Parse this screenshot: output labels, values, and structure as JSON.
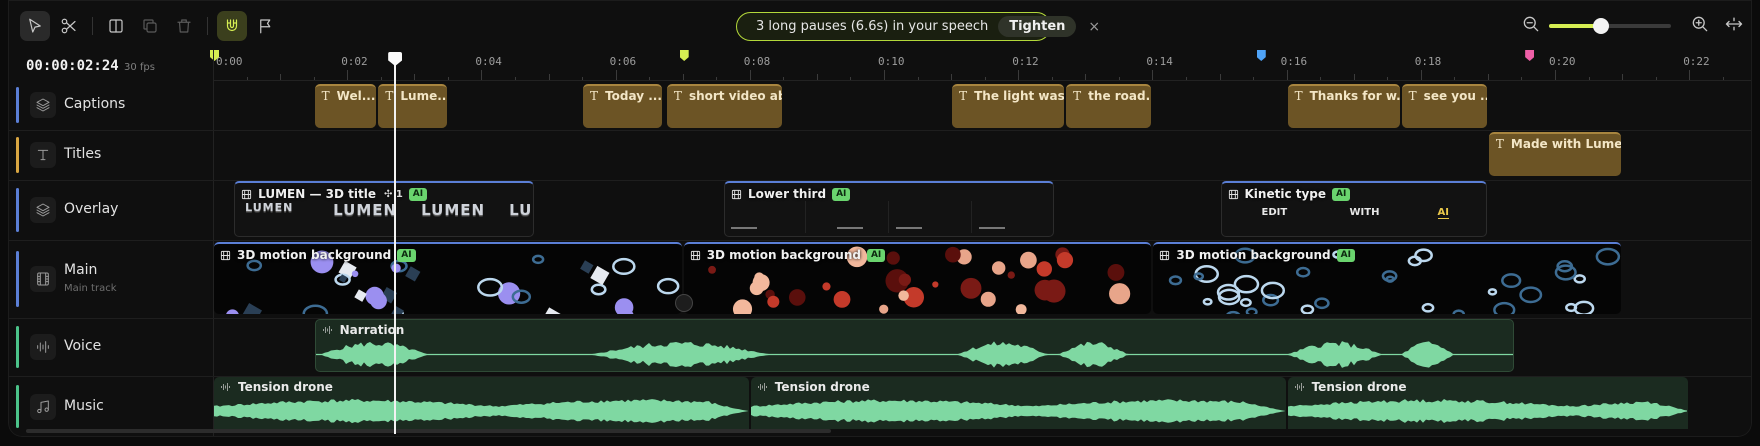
{
  "toolbar": {
    "tools": [
      {
        "name": "select-tool",
        "icon": "cursor-icon",
        "active": true
      },
      {
        "name": "cut-tool",
        "icon": "scissors-icon"
      },
      {
        "name": "split-tool",
        "icon": "split-icon"
      },
      {
        "name": "duplicate-tool",
        "icon": "copy-icon"
      },
      {
        "name": "delete-tool",
        "icon": "trash-icon"
      },
      {
        "name": "magnet-tool",
        "icon": "magnet-icon"
      },
      {
        "name": "marker-tool",
        "icon": "flag-icon"
      }
    ],
    "notice": {
      "message": "3 long pauses (6.6s) in your speech",
      "action": "Tighten",
      "close": "×"
    },
    "zoom": {
      "level": 0.43
    }
  },
  "header": {
    "timecode": "00:00:02:24",
    "fps": "30 fps"
  },
  "ruler": {
    "labels": [
      "0:00",
      "0:02",
      "0:04",
      "0:06",
      "0:08",
      "0:10",
      "0:12",
      "0:14",
      "0:16",
      "0:18",
      "0:20",
      "0:22"
    ]
  },
  "markers": [
    {
      "time": 0.0,
      "color": "#d6ee52"
    },
    {
      "time": 7.0,
      "color": "#d6ee52"
    },
    {
      "time": 15.6,
      "color": "#4fa3f7"
    },
    {
      "time": 19.6,
      "color": "#ef5fa7"
    }
  ],
  "playhead_time": 2.7,
  "tracks": [
    {
      "id": "captions",
      "name": "Captions",
      "icon": "layers-icon",
      "color": "#5b7fd6"
    },
    {
      "id": "titles",
      "name": "Titles",
      "icon": "text-icon",
      "color": "#d9a642"
    },
    {
      "id": "overlay",
      "name": "Overlay",
      "icon": "layers-icon",
      "color": "#5b7fd6"
    },
    {
      "id": "main",
      "name": "Main",
      "sub": "Main track",
      "icon": "film-icon",
      "color": "#5b7fd6"
    },
    {
      "id": "voice",
      "name": "Voice",
      "icon": "waveform-icon",
      "color": "#4cc38a"
    },
    {
      "id": "music",
      "name": "Music",
      "icon": "music-icon",
      "color": "#4cc38a"
    }
  ],
  "captions": [
    {
      "text": "Wel...",
      "start": 1.5,
      "end": 2.45
    },
    {
      "text": "Lume...",
      "start": 2.45,
      "end": 3.5
    },
    {
      "text": "Today ...",
      "start": 5.5,
      "end": 6.7
    },
    {
      "text": "short video ab...",
      "start": 6.75,
      "end": 8.5
    },
    {
      "text": "The light was...",
      "start": 11.0,
      "end": 12.7
    },
    {
      "text": "the road...",
      "start": 12.7,
      "end": 14.0
    },
    {
      "text": "Thanks for w...",
      "start": 16.0,
      "end": 17.7
    },
    {
      "text": "see you ...",
      "start": 17.7,
      "end": 19.0
    }
  ],
  "titles": [
    {
      "text": "Made with Lumen",
      "start": 19.0,
      "end": 21.0
    }
  ],
  "overlay": [
    {
      "text": "LUMEN — 3D title",
      "badge": "1",
      "ai": "AI",
      "start": 0.3,
      "end": 4.8,
      "frames": [
        "LUMEN",
        "LUMEN",
        "LUMEN",
        "LUI"
      ]
    },
    {
      "text": "Lower third",
      "ai": "AI",
      "start": 7.6,
      "end": 12.55
    },
    {
      "text": "Kinetic type",
      "ai": "AI",
      "start": 15.0,
      "end": 19.0,
      "words": [
        "EDIT",
        "WITH",
        "AI"
      ]
    }
  ],
  "main": [
    {
      "text": "3D motion background",
      "ai": "AI",
      "start": 0.0,
      "end": 7.0,
      "palette": "mixed"
    },
    {
      "text": "3D motion background",
      "ai": "AI",
      "start": 7.0,
      "end": 14.0,
      "palette": "spheres"
    },
    {
      "text": "3D motion background",
      "ai": "AI",
      "start": 14.0,
      "end": 21.0,
      "palette": "rings"
    }
  ],
  "voice": [
    {
      "text": "Narration",
      "start": 1.5,
      "end": 19.4
    }
  ],
  "music": [
    {
      "text": "Tension drone",
      "start": 0.0,
      "end": 8.0
    },
    {
      "text": "Tension drone",
      "start": 8.0,
      "end": 16.0
    },
    {
      "text": "Tension drone",
      "start": 16.0,
      "end": 22.0
    }
  ]
}
